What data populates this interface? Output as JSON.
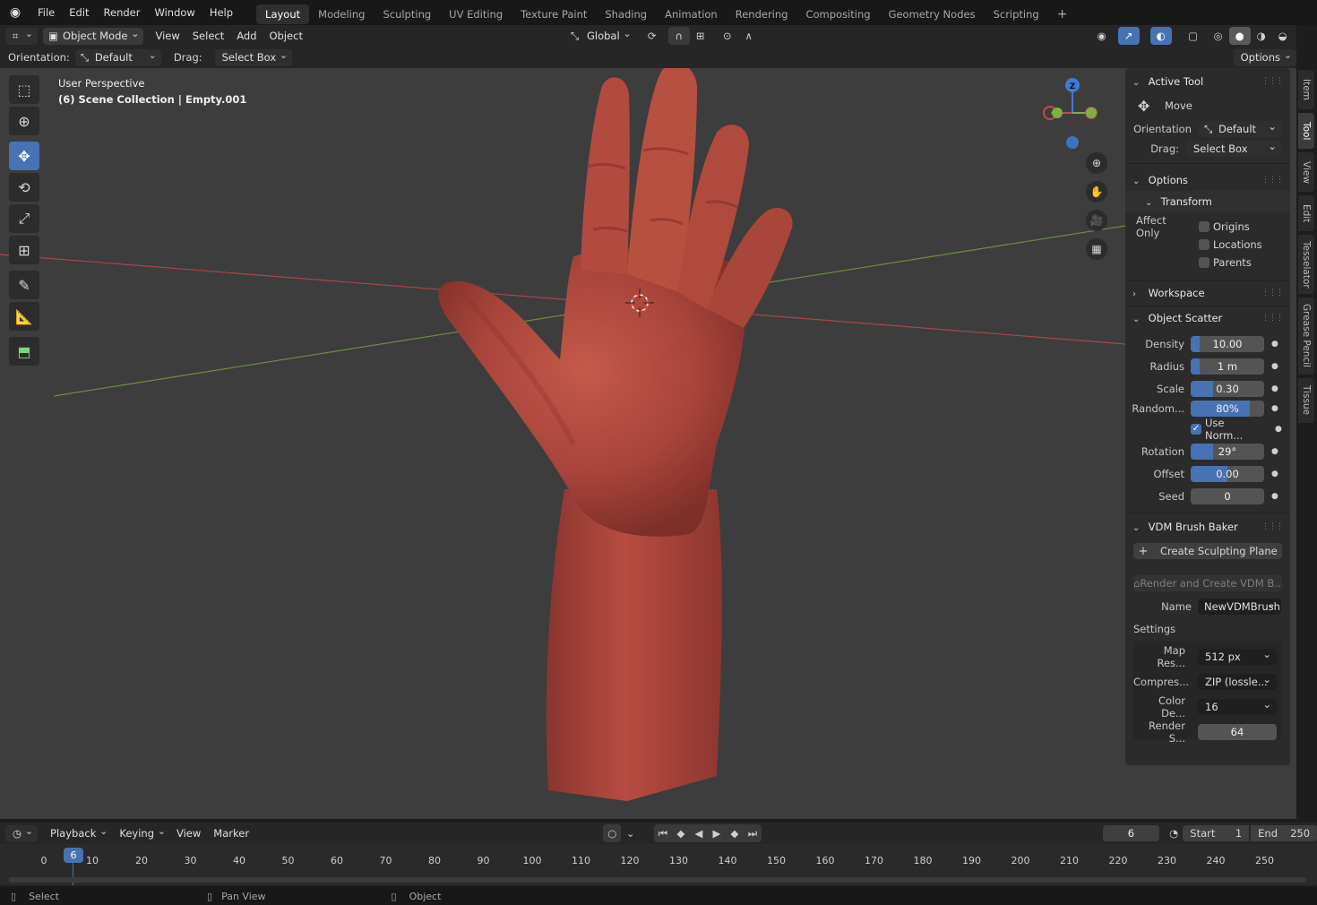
{
  "app": {
    "menu": [
      "File",
      "Edit",
      "Render",
      "Window",
      "Help"
    ],
    "workspaces": [
      "Layout",
      "Modeling",
      "Sculpting",
      "UV Editing",
      "Texture Paint",
      "Shading",
      "Animation",
      "Rendering",
      "Compositing",
      "Geometry Nodes",
      "Scripting"
    ],
    "active_workspace": "Layout",
    "add_workspace": "+"
  },
  "viewport_header": {
    "mode": "Object Mode",
    "menus": [
      "View",
      "Select",
      "Add",
      "Object"
    ],
    "transform_orientation": "Global",
    "options": "Options"
  },
  "tool_header": {
    "orientation_label": "Orientation:",
    "orientation_value": "Default",
    "drag_label": "Drag:",
    "drag_value": "Select Box"
  },
  "viewport": {
    "perspective": "User Perspective",
    "collection": "(6) Scene Collection | Empty.001",
    "gizmo_z": "Z"
  },
  "npanel": {
    "active_tool": {
      "title": "Active Tool",
      "tool_name": "Move",
      "orientation_label": "Orientation",
      "orientation_value": "Default",
      "drag_label": "Drag:",
      "drag_value": "Select Box"
    },
    "options": {
      "title": "Options",
      "transform_title": "Transform",
      "affect_only": "Affect Only",
      "origins": "Origins",
      "locations": "Locations",
      "parents": "Parents"
    },
    "workspace": {
      "title": "Workspace"
    },
    "object_scatter": {
      "title": "Object Scatter",
      "density_label": "Density",
      "density": "10.00",
      "density_fill": 0.12,
      "radius_label": "Radius",
      "radius": "1 m",
      "radius_fill": 0.12,
      "scale_label": "Scale",
      "scale": "0.30",
      "scale_fill": 0.3,
      "random_label": "Random...",
      "random": "80%",
      "random_fill": 0.8,
      "use_normal": "Use Norm...",
      "rotation_label": "Rotation",
      "rotation": "29°",
      "rotation_fill": 0.3,
      "offset_label": "Offset",
      "offset": "0.00",
      "offset_fill": 0.5,
      "seed_label": "Seed",
      "seed": "0"
    },
    "vdm": {
      "title": "VDM Brush Baker",
      "create_plane": "Create Sculpting Plane",
      "render_create": "Render and Create VDM B...",
      "name_label": "Name",
      "name_value": "NewVDMBrush",
      "settings_label": "Settings",
      "map_res_label": "Map Res...",
      "map_res": "512 px",
      "compress_label": "Compres...",
      "compress": "ZIP (lossle...",
      "color_depth_label": "Color De...",
      "color_depth": "16",
      "render_samples_label": "Render S...",
      "render_samples": "64"
    }
  },
  "side_tabs": [
    "Item",
    "Tool",
    "View",
    "Edit",
    "Tesselator",
    "Grease Pencil",
    "Tissue"
  ],
  "active_side_tab": "Tool",
  "timeline": {
    "menus": [
      "Playback",
      "Keying",
      "View",
      "Marker"
    ],
    "current_frame": "6",
    "start_label": "Start",
    "start": "1",
    "end_label": "End",
    "end": "250",
    "ticks": [
      "0",
      "10",
      "20",
      "30",
      "40",
      "50",
      "60",
      "70",
      "80",
      "90",
      "100",
      "110",
      "120",
      "130",
      "140",
      "150",
      "160",
      "170",
      "180",
      "190",
      "200",
      "210",
      "220",
      "230",
      "240",
      "250"
    ]
  },
  "statusbar": {
    "select": "Select",
    "pan": "Pan View",
    "object": "Object"
  },
  "colors": {
    "accent": "#4772b3",
    "skin": "#b34a3c",
    "x_axis": "#c9474f",
    "y_axis": "#7fae43",
    "z_axis": "#3e7bd6"
  }
}
